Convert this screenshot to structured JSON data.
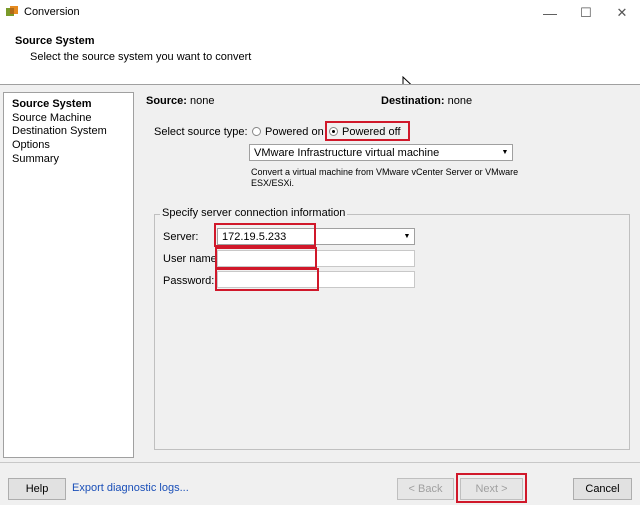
{
  "window": {
    "title": "Conversion",
    "minimize_glyph": "—",
    "maximize_glyph": "☐",
    "close_glyph": "✕"
  },
  "header": {
    "title": "Source System",
    "subtitle": "Select the source system you want to convert"
  },
  "sidebar": {
    "items": [
      {
        "label": "Source System",
        "active": true
      },
      {
        "label": "Source Machine",
        "active": false
      },
      {
        "label": "Destination System",
        "active": false
      },
      {
        "label": "Options",
        "active": false
      },
      {
        "label": "Summary",
        "active": false
      }
    ]
  },
  "main": {
    "source_label": "Source:",
    "source_value": "none",
    "destination_label": "Destination:",
    "destination_value": "none",
    "source_type_label": "Select source type:",
    "radio_powered_on": "Powered on",
    "radio_powered_off": "Powered off",
    "selected_source_type": "Powered off",
    "machine_type": "VMware Infrastructure virtual machine",
    "description": "Convert a virtual machine from VMware vCenter Server or VMware ESX/ESXi.",
    "connection_group": "Specify server connection information",
    "server_label": "Server:",
    "server_value": "172.19.5.233",
    "username_label": "User name:",
    "username_value": "",
    "password_label": "Password:",
    "password_value": ""
  },
  "footer": {
    "help": "Help",
    "export_logs": "Export diagnostic logs...",
    "back": "< Back",
    "next": "Next >",
    "cancel": "Cancel"
  },
  "colors": {
    "highlight": "#d0182a",
    "link": "#1a4fb8"
  }
}
